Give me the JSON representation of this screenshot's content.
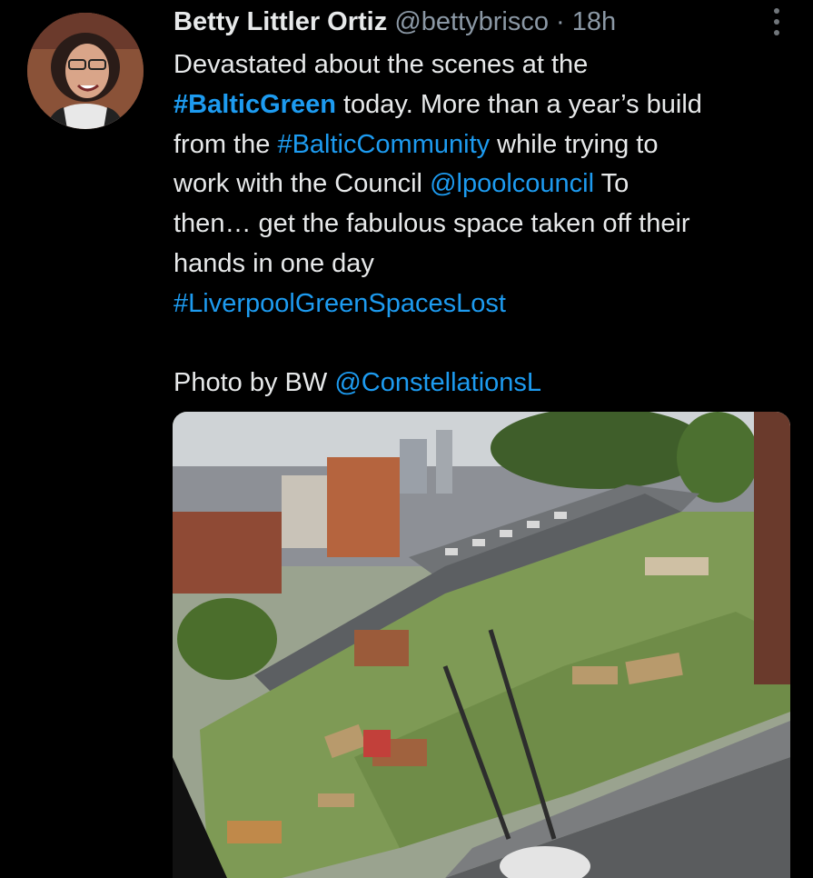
{
  "tweet": {
    "author_name": "Betty Littler Ortiz",
    "author_handle": "@bettybrisco",
    "separator": "·",
    "time": "18h",
    "text": {
      "l1": "Devastated about the scenes at the",
      "l2_tag": "#BalticGreen",
      "l2_rest": " today. More than a year’s build",
      "l3_a": "from the ",
      "l3_tag": "#BalticCommunity",
      "l3_b": " while trying to",
      "l4_a": "work with the Council ",
      "l4_mention": "@lpoolcouncil",
      "l4_b": " To",
      "l5": "then… get the fabulous space taken off their",
      "l6": "hands in one day",
      "l7_tag": "#LiverpoolGreenSpacesLost",
      "l9_a": "Photo by BW ",
      "l9_mention": "@ConstellationsL"
    }
  },
  "icons": {
    "more": "more-vertical-icon",
    "avatar": "avatar"
  },
  "colors": {
    "background": "#000000",
    "text": "#e7e9ea",
    "secondary": "#8b98a5",
    "link": "#1d9bf0"
  }
}
